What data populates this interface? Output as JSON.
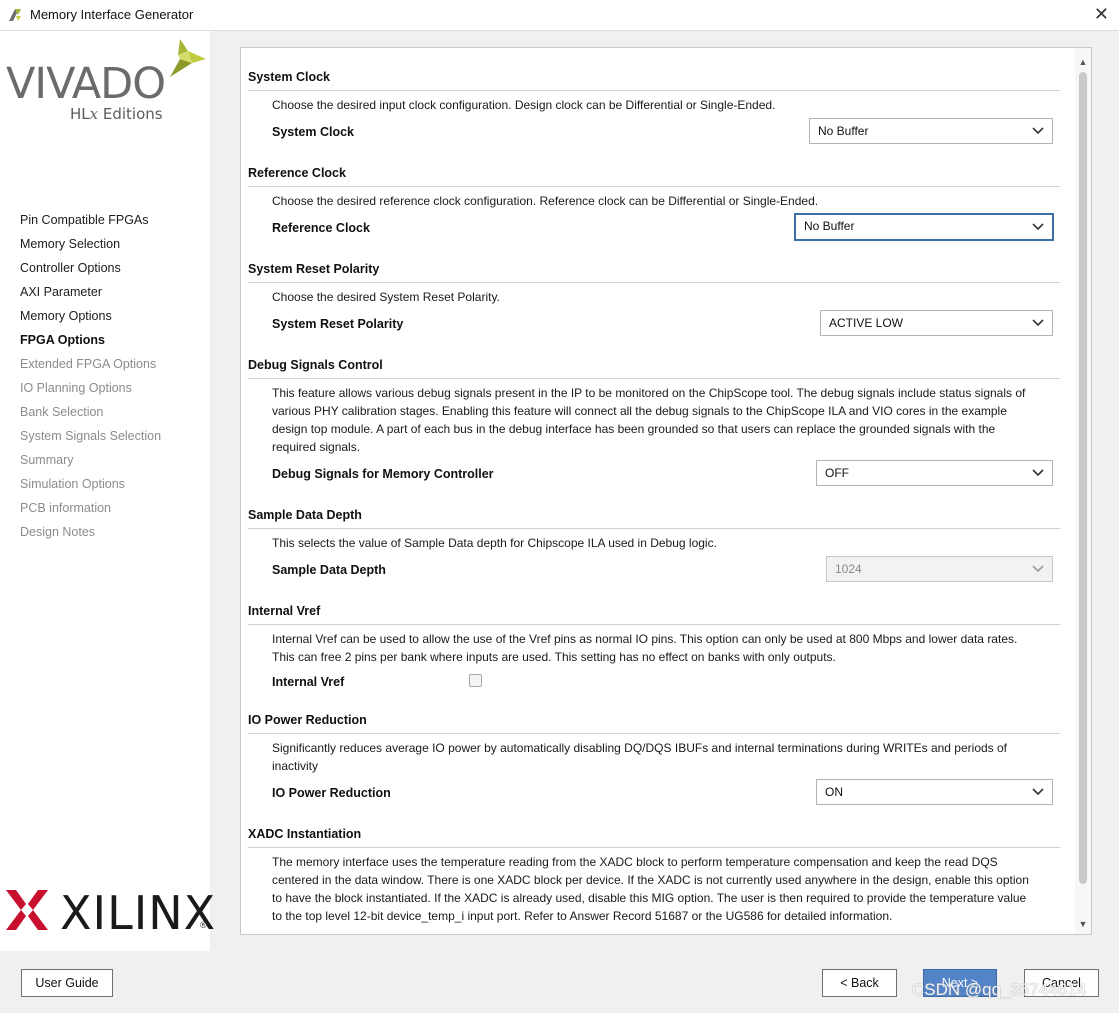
{
  "window": {
    "title": "Memory Interface Generator",
    "close_glyph": "✕"
  },
  "branding": {
    "vivado": "VIVADO",
    "hlx_prefix": "HL",
    "hlx_x": "x",
    "hlx_suffix": " Editions",
    "xilinx": "XILINX",
    "reg": "®",
    "accent_color": "#a7b535"
  },
  "nav": {
    "items": [
      {
        "label": "Pin Compatible FPGAs",
        "state": "normal"
      },
      {
        "label": "Memory Selection",
        "state": "normal"
      },
      {
        "label": "Controller Options",
        "state": "normal"
      },
      {
        "label": "AXI Parameter",
        "state": "normal"
      },
      {
        "label": "Memory Options",
        "state": "normal"
      },
      {
        "label": "FPGA Options",
        "state": "active"
      },
      {
        "label": "Extended FPGA Options",
        "state": "disabled"
      },
      {
        "label": "IO Planning Options",
        "state": "disabled"
      },
      {
        "label": "Bank Selection",
        "state": "disabled"
      },
      {
        "label": "System Signals Selection",
        "state": "disabled"
      },
      {
        "label": "Summary",
        "state": "disabled"
      },
      {
        "label": "Simulation Options",
        "state": "disabled"
      },
      {
        "label": "PCB information",
        "state": "disabled"
      },
      {
        "label": "Design Notes",
        "state": "disabled"
      }
    ]
  },
  "sections": {
    "system_clock": {
      "title": "System Clock",
      "desc": "Choose the desired input clock configuration. Design clock can be Differential or Single-Ended.",
      "label": "System Clock",
      "value": "No Buffer"
    },
    "reference_clock": {
      "title": "Reference Clock",
      "desc": "Choose the desired reference clock configuration. Reference clock can be Differential or Single-Ended.",
      "label": "Reference Clock",
      "value": "No Buffer"
    },
    "reset_polarity": {
      "title": "System Reset Polarity",
      "desc": "Choose the desired System Reset Polarity.",
      "label": "System Reset Polarity",
      "value": "ACTIVE LOW"
    },
    "debug": {
      "title": "Debug Signals Control",
      "desc_lines": [
        "This feature allows various debug signals present in the IP to be monitored on the ChipScope tool. The debug signals include status signals of",
        "various PHY calibration stages. Enabling this feature will connect all the debug signals to the ChipScope ILA and VIO cores in the example",
        "design top module. A part of each bus in the debug interface has been grounded so that users can replace the grounded signals with the",
        "required signals."
      ],
      "label": "Debug Signals for Memory Controller",
      "value": "OFF"
    },
    "sample_depth": {
      "title": "Sample Data Depth",
      "desc": "This selects the value of Sample Data depth for Chipscope ILA used in Debug logic.",
      "label": "Sample Data Depth",
      "value": "1024"
    },
    "internal_vref": {
      "title": "Internal Vref",
      "desc_lines": [
        "Internal Vref can be used to allow the use of the Vref pins as normal IO pins. This option can only be used at 800 Mbps and lower data rates.",
        "This can free 2 pins per bank where inputs are used. This setting has no effect on banks with only outputs."
      ],
      "label": "Internal Vref",
      "checked": false
    },
    "io_power": {
      "title": "IO Power Reduction",
      "desc_lines": [
        "Significantly reduces average IO power by automatically disabling DQ/DQS IBUFs and internal terminations during WRITEs and periods of",
        "inactivity"
      ],
      "label": "IO Power Reduction",
      "value": "ON"
    },
    "xadc": {
      "title": "XADC Instantiation",
      "desc_lines": [
        "The memory interface uses the temperature reading from the XADC block to perform temperature compensation and keep the read DQS",
        "centered in the data window. There is one XADC block per device. If the XADC is not currently used anywhere in the design, enable this option",
        "to have the block instantiated. If the XADC is already used, disable this MIG option. The user is then required to provide the temperature value",
        "to the top level 12-bit device_temp_i input port. Refer to Answer Record 51687 or the UG586 for detailed information."
      ]
    }
  },
  "footer": {
    "user_guide": "User Guide",
    "back": "< Back",
    "next": "Next >",
    "cancel": "Cancel",
    "watermark": "CSDN @qq_35744614",
    "primary_color": "#5384c7"
  }
}
